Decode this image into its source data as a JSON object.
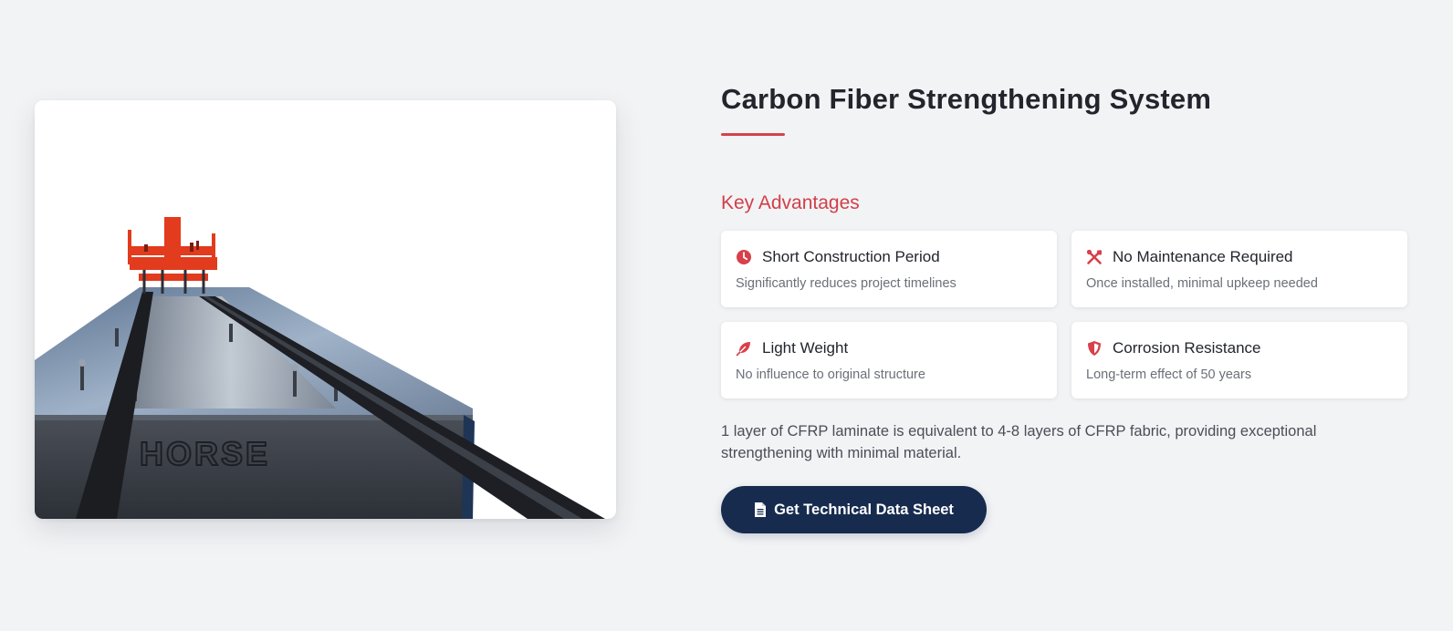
{
  "product": {
    "image_alt": "Carbon fiber plate production machine",
    "logo_text": "HORSE"
  },
  "hero": {
    "title": "Carbon Fiber Strengthening System",
    "advantages_heading": "Key Advantages",
    "advantages": [
      {
        "icon": "clock-icon",
        "title": "Short Construction Period",
        "description": "Significantly reduces project timelines"
      },
      {
        "icon": "tools-icon",
        "title": "No Maintenance Required",
        "description": "Once installed, minimal upkeep needed"
      },
      {
        "icon": "feather-icon",
        "title": "Light Weight",
        "description": "No influence to original structure"
      },
      {
        "icon": "shield-icon",
        "title": "Corrosion Resistance",
        "description": "Long-term effect of 50 years"
      }
    ],
    "description": "1 layer of CFRP laminate is equivalent to 4-8 layers of CFRP fabric, providing exceptional strengthening with minimal material.",
    "cta_label": "Get Technical Data Sheet"
  },
  "colors": {
    "accent": "#d13f49",
    "button_bg": "#172b4f",
    "background": "#f2f3f5"
  }
}
